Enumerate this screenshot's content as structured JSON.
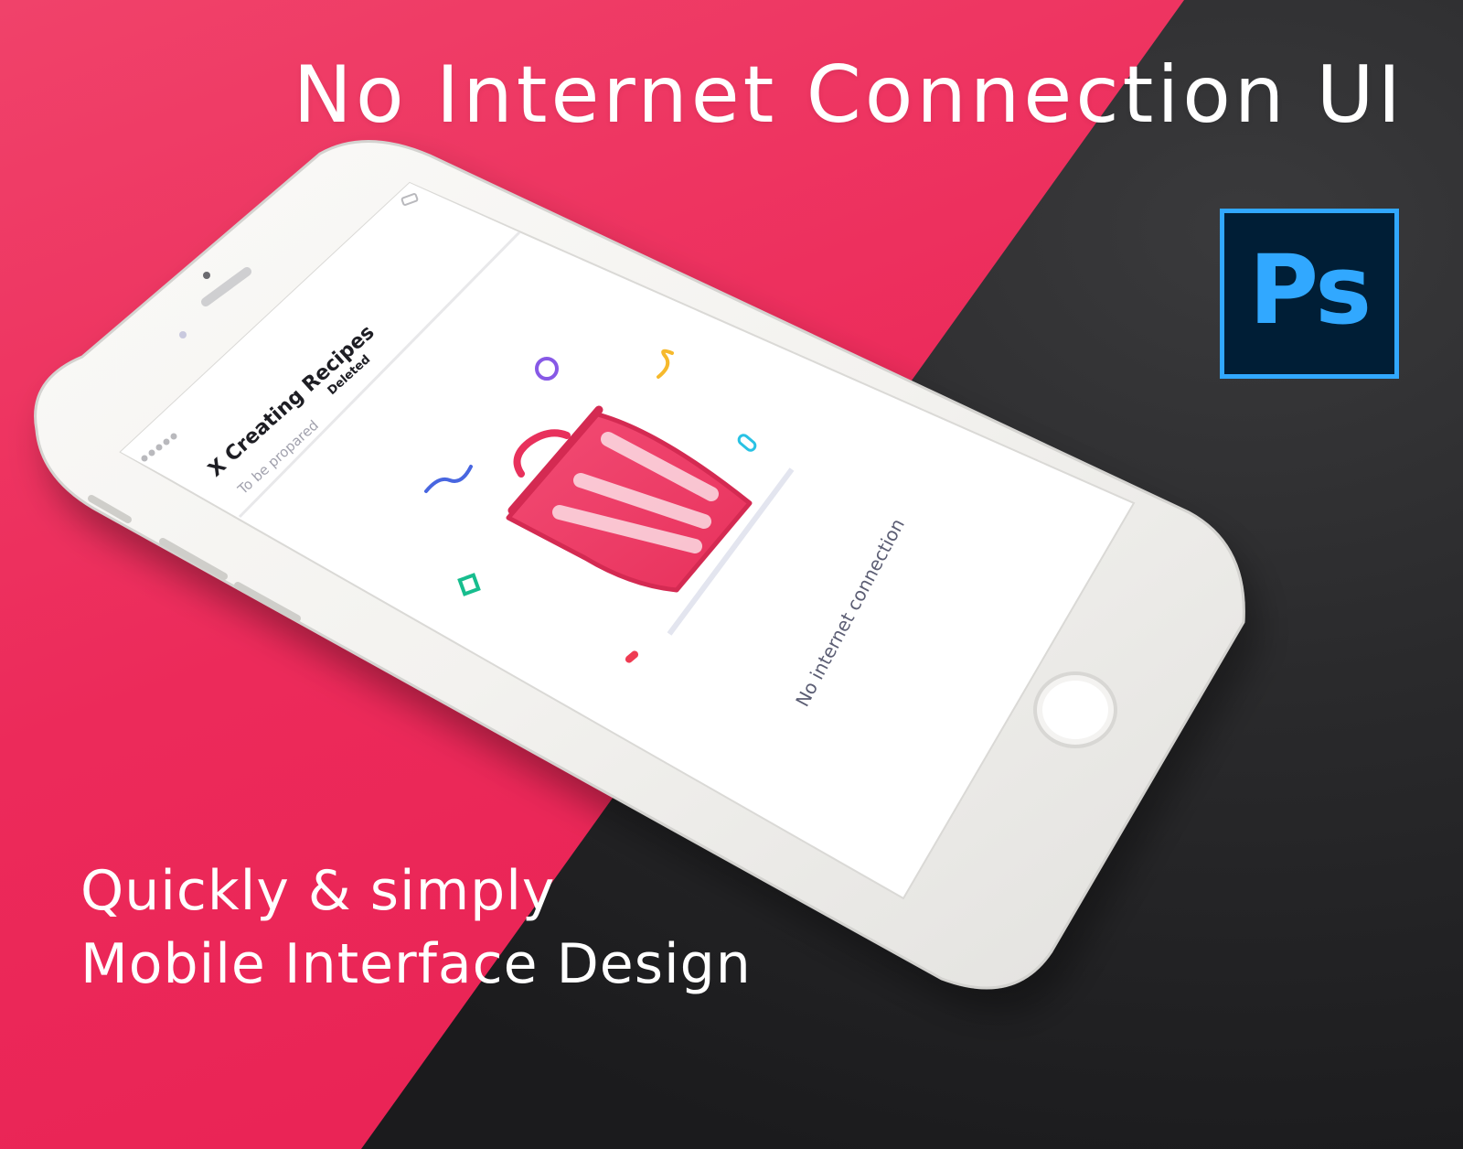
{
  "headline": "No Internet Connection UI",
  "app_badge": {
    "text": "Ps",
    "border_color": "#31a8ff",
    "bg_color": "#001e36"
  },
  "tagline": {
    "line1": "Quickly & simply",
    "line2": "Mobile Interface Design"
  },
  "phone": {
    "header": {
      "title": "X Creating Recipes",
      "status_primary": "To be propared",
      "status_secondary": "Deleted"
    },
    "illustration_icon": "trash-can-icon",
    "message": "No internet connection"
  },
  "colors": {
    "pink": "#ec2a5a",
    "dark": "#1f1f21",
    "trash": "#ef3b66",
    "message": "#5c5e74"
  }
}
